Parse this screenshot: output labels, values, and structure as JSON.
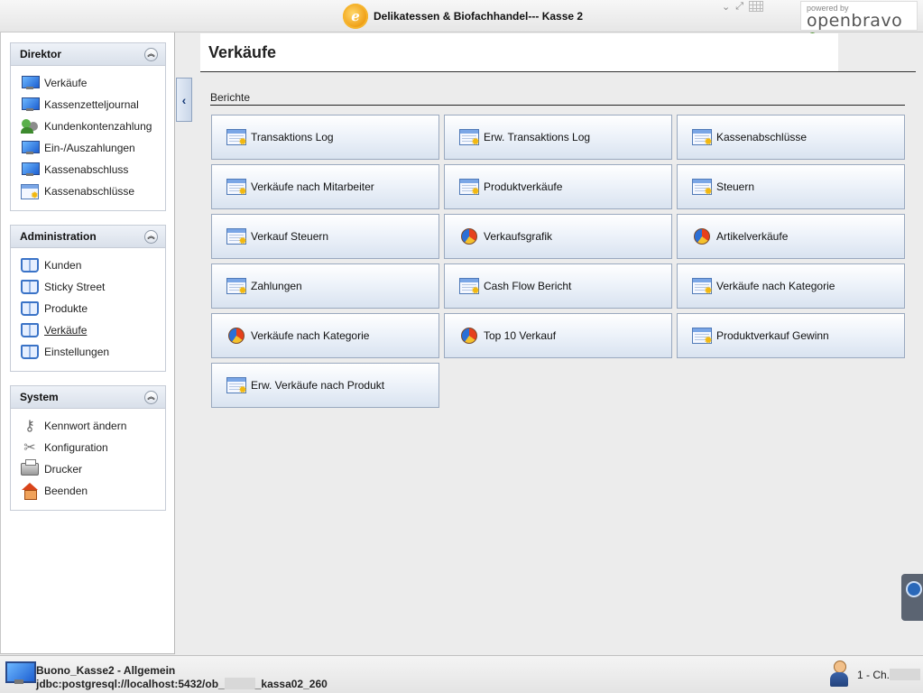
{
  "header": {
    "title": "Delikatessen & Biofachhandel--- Kasse 2",
    "logo_glyph": "ℯ",
    "window_controls": [
      "⌄",
      "⤢"
    ],
    "brand": {
      "powered_by": "powered by",
      "name": "openbravo"
    }
  },
  "sidebar": {
    "panels": [
      {
        "title": "Direktor",
        "items": [
          {
            "label": "Verkäufe",
            "icon": "monitor-icon"
          },
          {
            "label": "Kassenzetteljournal",
            "icon": "monitor-icon"
          },
          {
            "label": "Kundenkontenzahlung",
            "icon": "people-icon"
          },
          {
            "label": "Ein-/Auszahlungen",
            "icon": "monitor-icon"
          },
          {
            "label": "Kassenabschluss",
            "icon": "monitor-icon"
          },
          {
            "label": "Kassenabschlüsse",
            "icon": "report-icon"
          }
        ]
      },
      {
        "title": "Administration",
        "items": [
          {
            "label": "Kunden",
            "icon": "book-icon"
          },
          {
            "label": "Sticky Street",
            "icon": "book-icon"
          },
          {
            "label": "Produkte",
            "icon": "book-icon"
          },
          {
            "label": "Verkäufe",
            "icon": "book-icon",
            "selected": true
          },
          {
            "label": "Einstellungen",
            "icon": "book-icon"
          }
        ]
      },
      {
        "title": "System",
        "items": [
          {
            "label": "Kennwort ändern",
            "icon": "key-icon"
          },
          {
            "label": "Konfiguration",
            "icon": "tools-icon"
          },
          {
            "label": "Drucker",
            "icon": "printer-icon"
          },
          {
            "label": "Beenden",
            "icon": "home-icon"
          }
        ]
      }
    ],
    "collapse_glyph": "︽",
    "toggle_glyph": "‹"
  },
  "main": {
    "title": "Verkäufe",
    "section": "Berichte",
    "buttons": [
      {
        "label": "Transaktions Log",
        "icon": "report-icon"
      },
      {
        "label": "Erw. Transaktions Log",
        "icon": "report-icon"
      },
      {
        "label": "Kassenabschlüsse",
        "icon": "report-icon"
      },
      {
        "label": "Verkäufe nach Mitarbeiter",
        "icon": "report-icon"
      },
      {
        "label": "Produktverkäufe",
        "icon": "report-icon"
      },
      {
        "label": "Steuern",
        "icon": "report-icon"
      },
      {
        "label": "Verkauf Steuern",
        "icon": "report-icon"
      },
      {
        "label": "Verkaufsgrafik",
        "icon": "pie-chart-icon"
      },
      {
        "label": "Artikelverkäufe",
        "icon": "pie-chart-icon"
      },
      {
        "label": "Zahlungen",
        "icon": "report-icon"
      },
      {
        "label": "Cash Flow Bericht",
        "icon": "report-icon"
      },
      {
        "label": "Verkäufe nach Kategorie",
        "icon": "report-icon"
      },
      {
        "label": "Verkäufe nach Kategorie",
        "icon": "pie-chart-icon"
      },
      {
        "label": "Top 10 Verkauf",
        "icon": "pie-chart-icon"
      },
      {
        "label": "Produktverkauf Gewinn",
        "icon": "report-icon"
      },
      {
        "label": "Erw. Verkäufe nach Produkt",
        "icon": "report-icon"
      }
    ]
  },
  "status": {
    "line1": "Buono_Kasse2 - Allgemein",
    "line2_prefix": "jdbc:postgresql://localhost:5432/ob_",
    "line2_suffix": "_kassa02_260",
    "user": "1 - Ch."
  },
  "colors": {
    "accent": "#f0a21a",
    "button_border": "#9aa9bf",
    "brand_green": "#5aa13a"
  }
}
